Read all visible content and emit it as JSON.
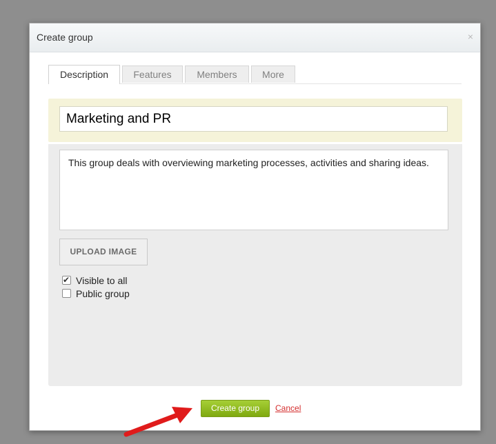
{
  "dialog": {
    "title": "Create group",
    "close_glyph": "×"
  },
  "tabs": [
    {
      "label": "Description",
      "active": true
    },
    {
      "label": "Features",
      "active": false
    },
    {
      "label": "Members",
      "active": false
    },
    {
      "label": "More",
      "active": false
    }
  ],
  "form": {
    "group_name": "Marketing and PR",
    "description": "This group deals with overviewing marketing processes, activities and sharing ideas.",
    "upload_label": "UPLOAD IMAGE",
    "checkboxes": [
      {
        "label": "Visible to all",
        "checked": true
      },
      {
        "label": "Public group",
        "checked": false
      }
    ]
  },
  "footer": {
    "create_label": "Create group",
    "cancel_label": "Cancel"
  },
  "colors": {
    "accent_green": "#8ab71f",
    "cancel_red": "#d42d2d",
    "arrow_red": "#e01b1b"
  }
}
